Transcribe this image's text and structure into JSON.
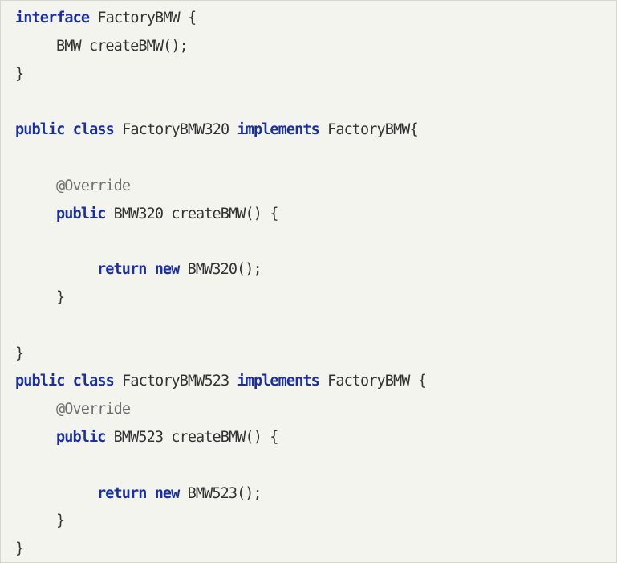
{
  "code": {
    "lines": [
      {
        "kw1": "interface",
        "text1": " FactoryBMW {"
      },
      {
        "text1": "BMW createBMW();"
      },
      {
        "text1": "}"
      },
      {
        "text1": ""
      },
      {
        "kw1": "public",
        "kw2": "class",
        "text1": " FactoryBMW320 ",
        "kw3": "implements",
        "text2": " FactoryBMW{"
      },
      {
        "text1": ""
      },
      {
        "ann": "@Override"
      },
      {
        "kw1": "public",
        "text1": " BMW320 createBMW() {"
      },
      {
        "text1": ""
      },
      {
        "kw1": "return",
        "kw2": "new",
        "text1": " BMW320();"
      },
      {
        "text1": "}"
      },
      {
        "text1": ""
      },
      {
        "text1": "}"
      },
      {
        "kw1": "public",
        "kw2": "class",
        "text1": " FactoryBMW523 ",
        "kw3": "implements",
        "text2": " FactoryBMW {"
      },
      {
        "ann": "@Override"
      },
      {
        "kw1": "public",
        "text1": " BMW523 createBMW() {"
      },
      {
        "text1": ""
      },
      {
        "kw1": "return",
        "kw2": "new",
        "text1": " BMW523();"
      },
      {
        "text1": "}"
      },
      {
        "text1": "}"
      }
    ]
  }
}
